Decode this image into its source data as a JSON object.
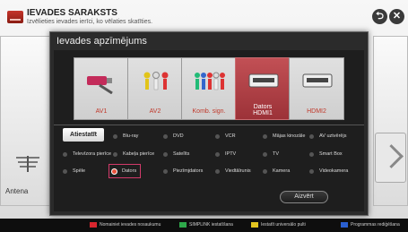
{
  "header": {
    "title": "IEVADES SARAKSTS",
    "subtitle": "Izvēlieties ievades ierīci, ko vēlaties skatīties."
  },
  "buttons": {
    "back_glyph": "⮌",
    "close_glyph": "✕"
  },
  "background": {
    "left_tile_label": "Antena"
  },
  "dialog": {
    "title": "Ievades apzīmējums",
    "cards": [
      {
        "label": "AV1",
        "icon": "scart-cable-icon",
        "selected": false
      },
      {
        "label": "AV2",
        "icon": "rca-3-connector-icon",
        "selected": false
      },
      {
        "label": "Komb. sign.",
        "icon": "component-5-connector-icon",
        "selected": false
      },
      {
        "label": "Dators\nHDMI1",
        "icon": "hdmi-port-icon",
        "selected": true
      },
      {
        "label": "HDMI2",
        "icon": "hdmi-port-icon",
        "selected": false
      }
    ],
    "filter_tab": "Atiestatīt",
    "options": [
      [
        "Blu-ray",
        "DVD",
        "VCR",
        "Mājas kinozāle",
        "AV uztvērējs"
      ],
      [
        "Televīzora pierīce",
        "Kabeļa pierīce",
        "Satelīts",
        "IPTV",
        "TV",
        "Smart Box"
      ],
      [
        "Spēle",
        "Dators",
        "Piezīmjdators",
        "Viedtālrunis",
        "Kamera",
        "Videokamera"
      ]
    ],
    "selected_option": "Dators",
    "close_label": "Aizvērt"
  },
  "bottom_bar": [
    {
      "label": "Nomainiet ievades nosaukumu",
      "color": "#d8262e"
    },
    {
      "label": "SIMPLINK iestatīšana",
      "color": "#2ea84a"
    },
    {
      "label": "Iestatīt universālo pulti",
      "color": "#e3c520"
    },
    {
      "label": "Programmas rediģēšana",
      "color": "#2a5fd0"
    }
  ]
}
